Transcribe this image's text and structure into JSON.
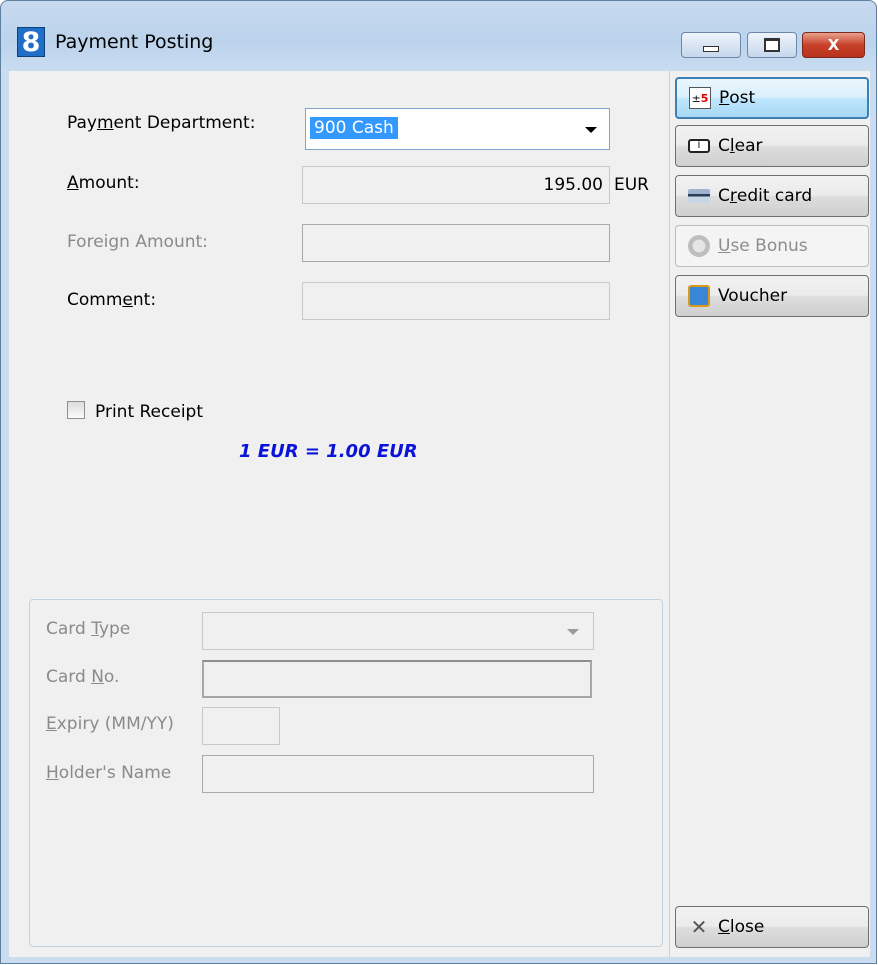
{
  "window": {
    "title": "Payment Posting",
    "app_icon": "8",
    "controls": {
      "minimize": "minimize-icon",
      "maximize": "maximize-icon",
      "close": "X"
    }
  },
  "form": {
    "payment_department": {
      "label_pre": "Pay",
      "label_acc": "m",
      "label_post": "ent Department:",
      "value": "900  Cash"
    },
    "amount": {
      "label_acc": "A",
      "label_post": "mount:",
      "value": "195.00",
      "currency": "EUR"
    },
    "foreign_amount": {
      "label_pre": "Forei",
      "label_acc": "g",
      "label_post": "n Amount:",
      "value": ""
    },
    "comment": {
      "label_pre": "Comm",
      "label_acc": "e",
      "label_post": "nt:",
      "value": ""
    },
    "print_receipt": {
      "label": "Print Receipt",
      "checked": false
    },
    "exchange_rate": "1 EUR = 1.00 EUR"
  },
  "card": {
    "card_type": {
      "label_pre": "Card ",
      "label_acc": "T",
      "label_post": "ype",
      "value": ""
    },
    "card_no": {
      "label_pre": "Card ",
      "label_acc": "N",
      "label_post": "o.",
      "value": ""
    },
    "expiry": {
      "label_acc": "E",
      "label_post": "xpiry (MM/YY)",
      "value": ""
    },
    "holder_name": {
      "label_acc": "H",
      "label_post": "older's Name",
      "value": ""
    }
  },
  "buttons": {
    "post": {
      "acc": "P",
      "rest": "ost",
      "icon": "calculator-icon"
    },
    "clear": {
      "pre": "C",
      "acc": "l",
      "rest": "ear",
      "icon": "eraser-icon"
    },
    "credit_card": {
      "pre": "C",
      "acc": "r",
      "rest": "edit card",
      "icon": "credit-card-icon"
    },
    "use_bonus": {
      "acc": "U",
      "rest": "se Bonus",
      "icon": "ribbon-award-icon"
    },
    "voucher": {
      "label": "Voucher",
      "icon": "gift-icon"
    },
    "close": {
      "acc": "C",
      "rest": "lose",
      "icon": "tools-icon"
    }
  },
  "colors": {
    "title_bar": "#bcd3ec",
    "rate_text": "#0a14d8",
    "selection": "#3399ff",
    "close_button": "#c8412a"
  }
}
